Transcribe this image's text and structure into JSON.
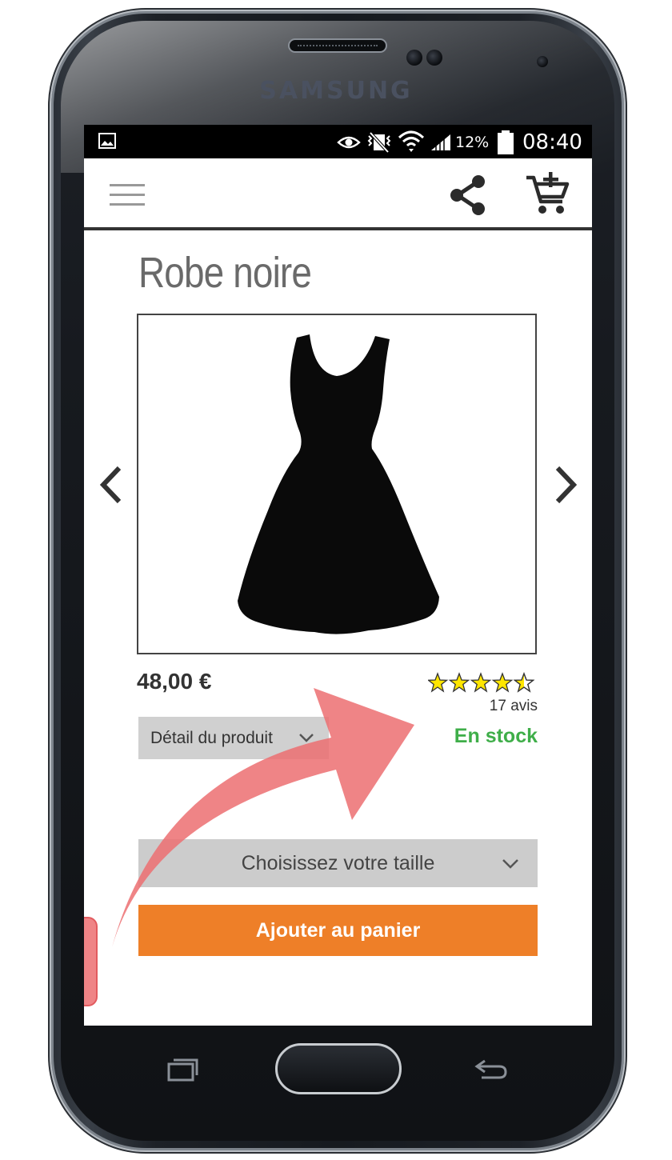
{
  "device": {
    "brand": "SAMSUNG"
  },
  "status_bar": {
    "battery_percent": "12%",
    "time": "08:40",
    "icons": [
      "image-notification-icon",
      "eye-icon",
      "vibrate-icon",
      "wifi-icon",
      "signal-icon",
      "battery-icon"
    ]
  },
  "app_bar": {
    "icons": [
      "hamburger-menu-icon",
      "share-icon",
      "add-to-cart-icon"
    ]
  },
  "product": {
    "name": "Robe noire",
    "price": "48,00 €",
    "rating_stars": 4.5,
    "rating_max": 5,
    "reviews_count": "17 avis",
    "stock_status": "En stock",
    "detail_label": "Détail du produit",
    "size_placeholder": "Choisissez votre taille",
    "add_to_cart_label": "Ajouter au panier"
  },
  "colors": {
    "accent_orange": "#ee7f28",
    "stock_green": "#3fae49",
    "star_yellow": "#ffe600",
    "arrow_overlay": "#ec6e71",
    "button_gray": "#cccccc"
  }
}
